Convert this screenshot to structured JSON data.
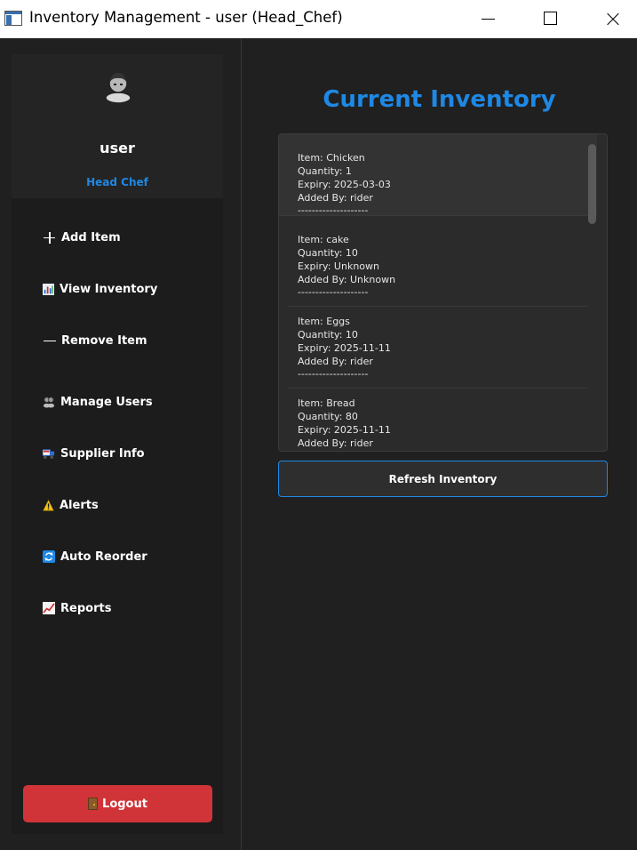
{
  "window": {
    "title": "Inventory Management - user (Head_Chef)"
  },
  "profile": {
    "username": "user",
    "role": "Head Chef",
    "avatar_icon": "person-icon"
  },
  "sidebar": {
    "items": [
      {
        "label": "Add Item",
        "icon": "plus-icon"
      },
      {
        "label": "View Inventory",
        "icon": "bar-chart-icon"
      },
      {
        "label": "Remove Item",
        "icon": "minus-icon"
      },
      {
        "label": "Manage Users",
        "icon": "users-icon"
      },
      {
        "label": "Supplier Info",
        "icon": "truck-icon"
      },
      {
        "label": "Alerts",
        "icon": "warning-icon"
      },
      {
        "label": "Auto Reorder",
        "icon": "refresh-icon"
      },
      {
        "label": "Reports",
        "icon": "line-chart-icon"
      }
    ],
    "logout_label": "Logout"
  },
  "main": {
    "title": "Current Inventory",
    "refresh_label": "Refresh Inventory",
    "inventory": [
      {
        "item": "Item: Chicken",
        "quantity": "Quantity: 1",
        "expiry": "Expiry: 2025-03-03",
        "added_by": "Added By: rider",
        "separator": "--------------------"
      },
      {
        "item": "Item: cake",
        "quantity": "Quantity: 10",
        "expiry": "Expiry: Unknown",
        "added_by": "Added By: Unknown",
        "separator": "--------------------"
      },
      {
        "item": "Item: Eggs",
        "quantity": "Quantity: 10",
        "expiry": "Expiry: 2025-11-11",
        "added_by": "Added By: rider",
        "separator": "--------------------"
      },
      {
        "item": "Item: Bread",
        "quantity": "Quantity: 80",
        "expiry": "Expiry: 2025-11-11",
        "added_by": "Added By: rider",
        "separator": "--------------------"
      }
    ]
  },
  "colors": {
    "accent": "#1e88e5",
    "logout": "#d13438",
    "background": "#202020"
  }
}
